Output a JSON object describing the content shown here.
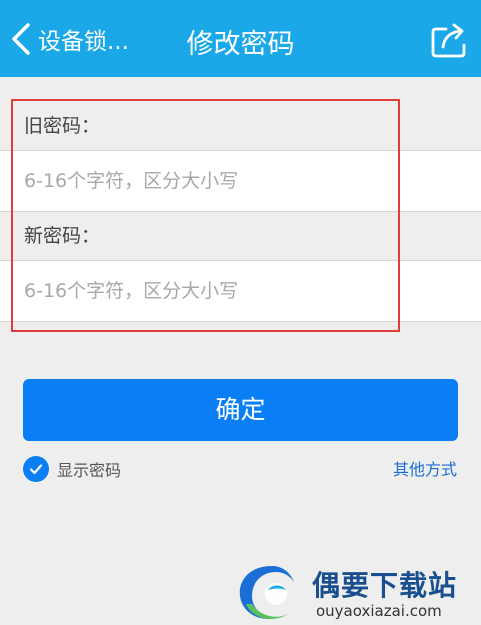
{
  "header": {
    "back_label": "设备锁...",
    "title": "修改密码",
    "background": "#1aa8e8"
  },
  "form": {
    "old_password_label": "旧密码：",
    "old_password_placeholder": "6-16个字符，区分大小写",
    "old_password_value": "",
    "new_password_label": "新密码：",
    "new_password_placeholder": "6-16个字符，区分大小写",
    "new_password_value": "",
    "highlight_color": "#e03c3c"
  },
  "actions": {
    "confirm_label": "确定",
    "confirm_color": "#0a7ff5",
    "show_password_label": "显示密码",
    "show_password_checked": true,
    "other_methods_label": "其他方式"
  },
  "watermark": {
    "title": "偶要下载站",
    "domain": "ouyaoxiazai.com"
  },
  "icons": {
    "back": "chevron-left-icon",
    "share": "share-icon",
    "check": "checkmark-icon"
  }
}
